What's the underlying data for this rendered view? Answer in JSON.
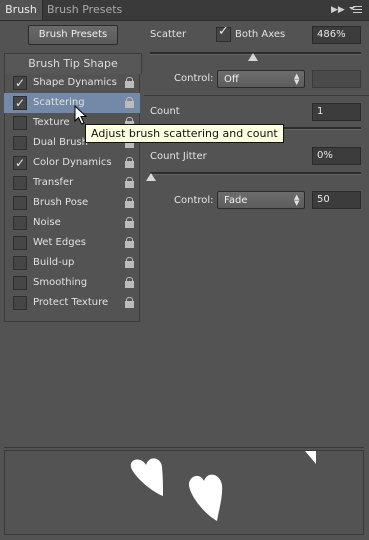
{
  "tabs": [
    {
      "label": "Brush"
    },
    {
      "label": "Brush Presets"
    }
  ],
  "left": {
    "preset_button": "Brush Presets",
    "tip_shape": "Brush Tip Shape",
    "items": [
      {
        "label": "Shape Dynamics",
        "checked": true
      },
      {
        "label": "Scattering",
        "checked": true,
        "selected": true
      },
      {
        "label": "Texture",
        "checked": false
      },
      {
        "label": "Dual Brush",
        "checked": false
      },
      {
        "label": "Color Dynamics",
        "checked": true
      },
      {
        "label": "Transfer",
        "checked": false
      },
      {
        "label": "Brush Pose",
        "checked": false
      },
      {
        "label": "Noise",
        "checked": false
      },
      {
        "label": "Wet Edges",
        "checked": false
      },
      {
        "label": "Build-up",
        "checked": false
      },
      {
        "label": "Smoothing",
        "checked": false
      },
      {
        "label": "Protect Texture",
        "checked": false
      }
    ]
  },
  "scatter": {
    "label": "Scatter",
    "both_axes_label": "Both Axes",
    "both_axes_checked": true,
    "value": "486%",
    "control_label": "Control:",
    "control_value": "Off"
  },
  "count": {
    "label": "Count",
    "value": "1"
  },
  "count_jitter": {
    "label": "Count Jitter",
    "value": "0%",
    "control_label": "Control:",
    "control_value": "Fade",
    "fade_steps": "50"
  },
  "tooltip": "Adjust brush scattering and count"
}
